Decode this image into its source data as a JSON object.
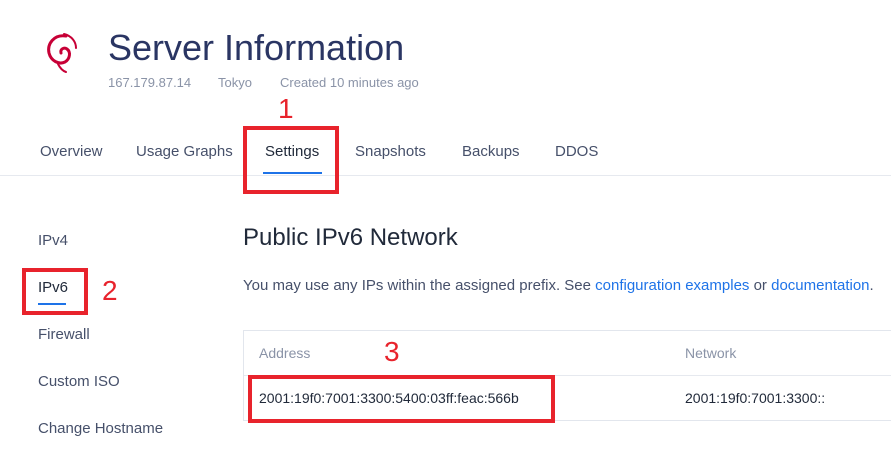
{
  "header": {
    "title": "Server Information",
    "ip": "167.179.87.14",
    "location": "Tokyo",
    "created": "Created 10 minutes ago",
    "logo_icon": "debian-swirl-icon",
    "logo_color": "#c70036"
  },
  "tabs": [
    {
      "label": "Overview"
    },
    {
      "label": "Usage Graphs"
    },
    {
      "label": "Settings"
    },
    {
      "label": "Snapshots"
    },
    {
      "label": "Backups"
    },
    {
      "label": "DDOS"
    }
  ],
  "active_tab": "Settings",
  "sidebar": {
    "items": [
      {
        "label": "IPv4"
      },
      {
        "label": "IPv6"
      },
      {
        "label": "Firewall"
      },
      {
        "label": "Custom ISO"
      },
      {
        "label": "Change Hostname"
      }
    ],
    "active": "IPv6"
  },
  "main": {
    "heading": "Public IPv6 Network",
    "desc_prefix": "You may use any IPs within the assigned prefix. See ",
    "link1": "configuration examples",
    "desc_mid": " or ",
    "link2": "documentation",
    "desc_suffix": ".",
    "table": {
      "columns": [
        "Address",
        "Network"
      ],
      "rows": [
        [
          "2001:19f0:7001:3300:5400:03ff:feac:566b",
          "2001:19f0:7001:3300::"
        ]
      ]
    }
  },
  "annotations": {
    "labels": [
      "1",
      "2",
      "3"
    ],
    "color": "#e8232c"
  },
  "colors": {
    "accent": "#1e73e8",
    "title": "#2a3563"
  }
}
